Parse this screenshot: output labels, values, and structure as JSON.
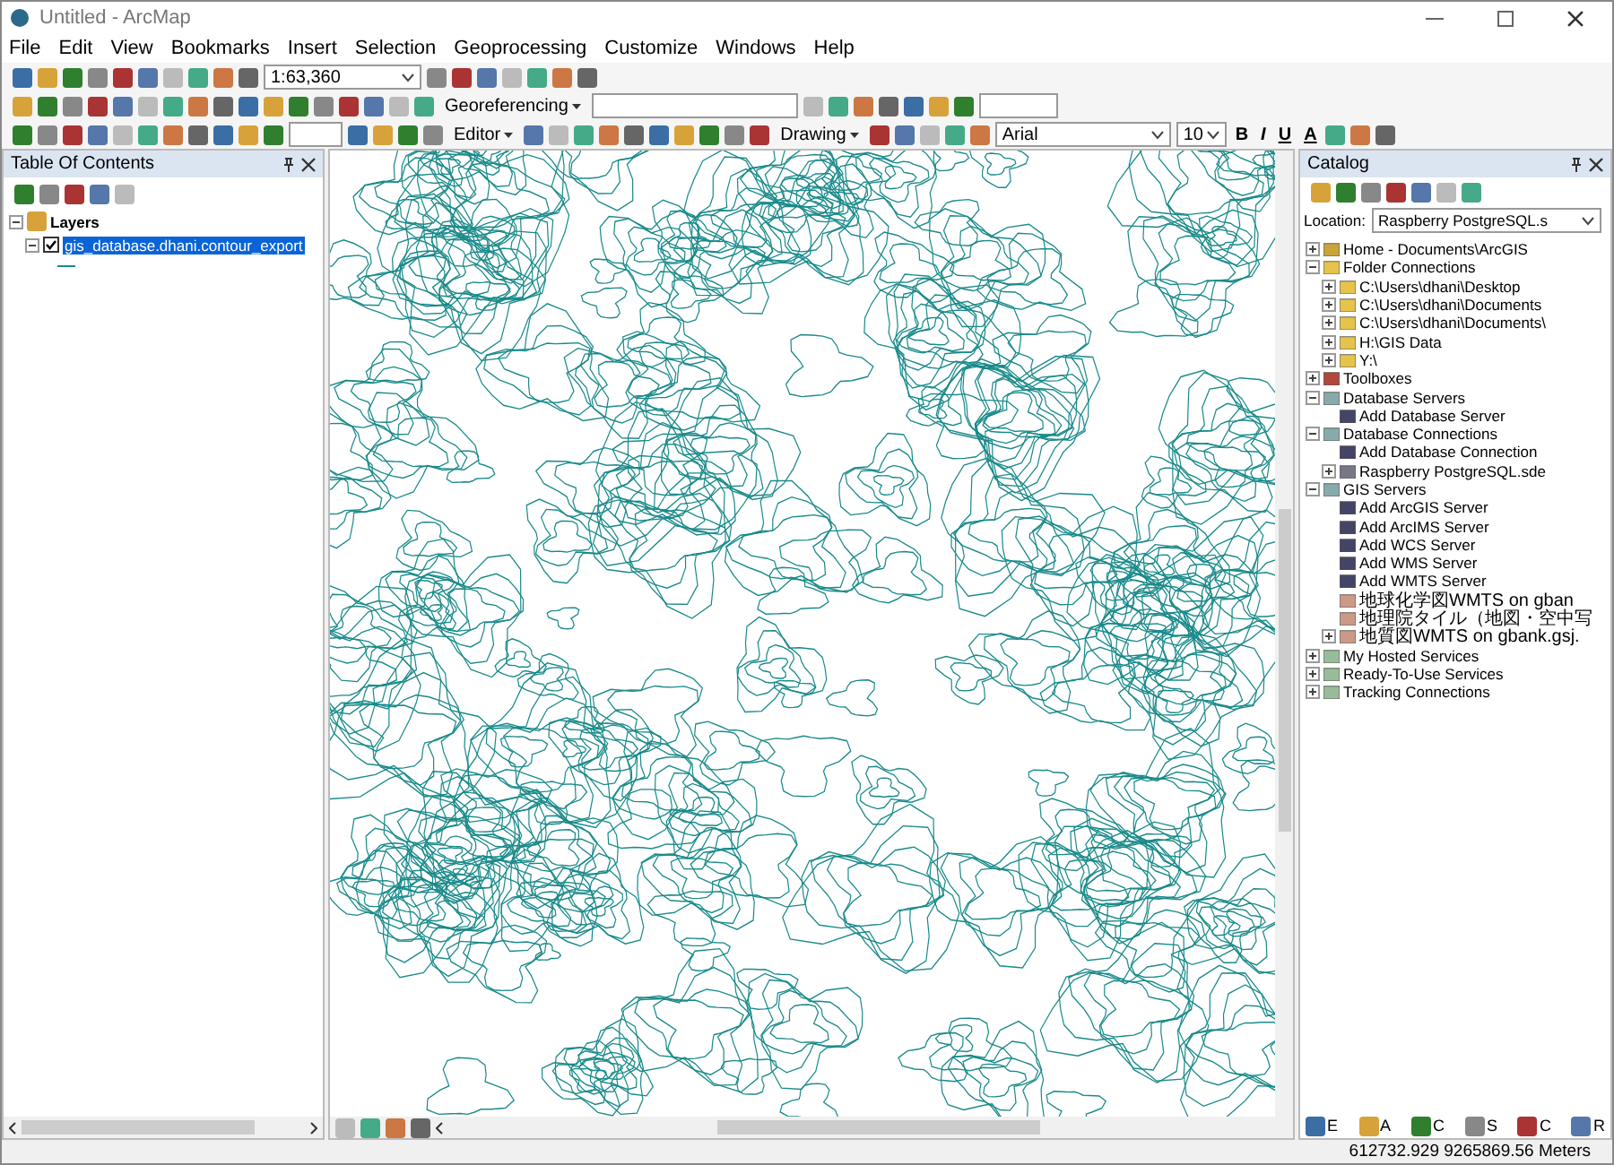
{
  "window": {
    "title": "Untitled - ArcMap"
  },
  "menu": [
    "File",
    "Edit",
    "View",
    "Bookmarks",
    "Insert",
    "Selection",
    "Geoprocessing",
    "Customize",
    "Windows",
    "Help"
  ],
  "toolbar": {
    "scale": "1:63,360",
    "georeferencing": "Georeferencing",
    "editor": "Editor",
    "drawing": "Drawing",
    "font": "Arial",
    "font_size": "10",
    "bold": "B",
    "italic": "I",
    "underline": "U",
    "font_color": "A"
  },
  "toc": {
    "title": "Table Of Contents",
    "root": {
      "label": "Layers",
      "expanded": true,
      "children": [
        {
          "label": "gis_database.dhani.contour_export",
          "checked": true,
          "selected": true,
          "expanded": true
        }
      ]
    }
  },
  "catalog": {
    "title": "Catalog",
    "location_label": "Location:",
    "location": "Raspberry PostgreSQL.s",
    "tree": [
      {
        "label": "Home - Documents\\ArcGIS",
        "kind": "home",
        "expanded": false
      },
      {
        "label": "Folder Connections",
        "kind": "folder",
        "expanded": true,
        "children": [
          {
            "label": "C:\\Users\\dhani\\Desktop",
            "kind": "folder",
            "expanded": false
          },
          {
            "label": "C:\\Users\\dhani\\Documents",
            "kind": "folder",
            "expanded": false
          },
          {
            "label": "C:\\Users\\dhani\\Documents\\",
            "kind": "folder",
            "expanded": false
          },
          {
            "label": "H:\\GIS Data",
            "kind": "folder",
            "expanded": false
          },
          {
            "label": "Y:\\",
            "kind": "folder",
            "expanded": false
          }
        ]
      },
      {
        "label": "Toolboxes",
        "kind": "toolbox",
        "expanded": false
      },
      {
        "label": "Database Servers",
        "kind": "server",
        "expanded": true,
        "children": [
          {
            "label": "Add Database Server",
            "kind": "add"
          }
        ]
      },
      {
        "label": "Database Connections",
        "kind": "server",
        "expanded": true,
        "children": [
          {
            "label": "Add Database Connection",
            "kind": "add"
          },
          {
            "label": "Raspberry PostgreSQL.sde",
            "kind": "database",
            "expanded": false
          }
        ]
      },
      {
        "label": "GIS Servers",
        "kind": "server",
        "expanded": true,
        "children": [
          {
            "label": "Add ArcGIS Server",
            "kind": "add"
          },
          {
            "label": "Add ArcIMS Server",
            "kind": "add"
          },
          {
            "label": "Add WCS Server",
            "kind": "add"
          },
          {
            "label": "Add WMS Server",
            "kind": "add"
          },
          {
            "label": "Add WMTS Server",
            "kind": "add"
          },
          {
            "label": "地球化学図WMTS on gban",
            "kind": "wmts"
          },
          {
            "label": "地理院タイル（地図・空中写",
            "kind": "wmts"
          },
          {
            "label": "地質図WMTS on gbank.gsj.",
            "kind": "wmts",
            "expanded": false
          }
        ]
      },
      {
        "label": "My Hosted Services",
        "kind": "service",
        "expanded": false
      },
      {
        "label": "Ready-To-Use Services",
        "kind": "service",
        "expanded": false
      },
      {
        "label": "Tracking Connections",
        "kind": "service",
        "expanded": false
      }
    ]
  },
  "catalog_tabs": [
    "E",
    "A",
    "C",
    "S",
    "C",
    "R"
  ],
  "status": {
    "coordinates": "612732.929  9265869.56 Meters"
  }
}
